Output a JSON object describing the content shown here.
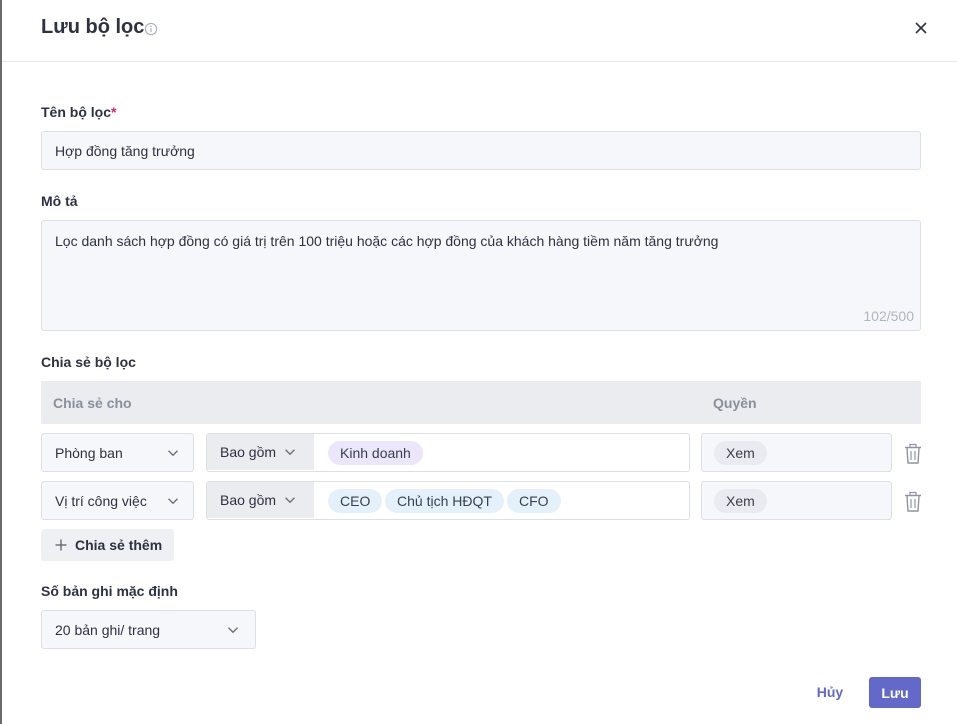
{
  "dialog": {
    "title": "Lưu bộ lọc",
    "info_icon": "info-circle-icon",
    "close_icon": "close-icon"
  },
  "filter_name": {
    "label": "Tên bộ lọc",
    "required_mark": "*",
    "value": "Hợp đồng tăng trưởng"
  },
  "description": {
    "label": "Mô tả",
    "value": "Lọc danh sách hợp đồng có giá trị trên 100 triệu hoặc các hợp đồng của khách hàng tiềm năm tăng trưởng",
    "counter": "102/500"
  },
  "share": {
    "label": "Chia sẻ bộ lọc",
    "columns": {
      "share_to": "Chia sẻ cho",
      "permission": "Quyền"
    },
    "rows": [
      {
        "type": "Phòng ban",
        "operator": "Bao gồm",
        "values": [
          "Kinh doanh"
        ],
        "permission": "Xem"
      },
      {
        "type": "Vị trí công việc",
        "operator": "Bao gồm",
        "values": [
          "CEO",
          "Chủ tịch HĐQT",
          "CFO"
        ],
        "permission": "Xem"
      }
    ],
    "add_label": "Chia sẻ thêm"
  },
  "default_records": {
    "label": "Số bản ghi mặc định",
    "value": "20 bản ghi/ trang"
  },
  "footer": {
    "cancel_label": "Hủy",
    "save_label": "Lưu"
  },
  "colors": {
    "primary": "#6269c8",
    "required": "#e0245e",
    "chip_department": "#ece6fa",
    "chip_position": "#e4f1fb",
    "chip_permission": "#e9ebf0"
  }
}
